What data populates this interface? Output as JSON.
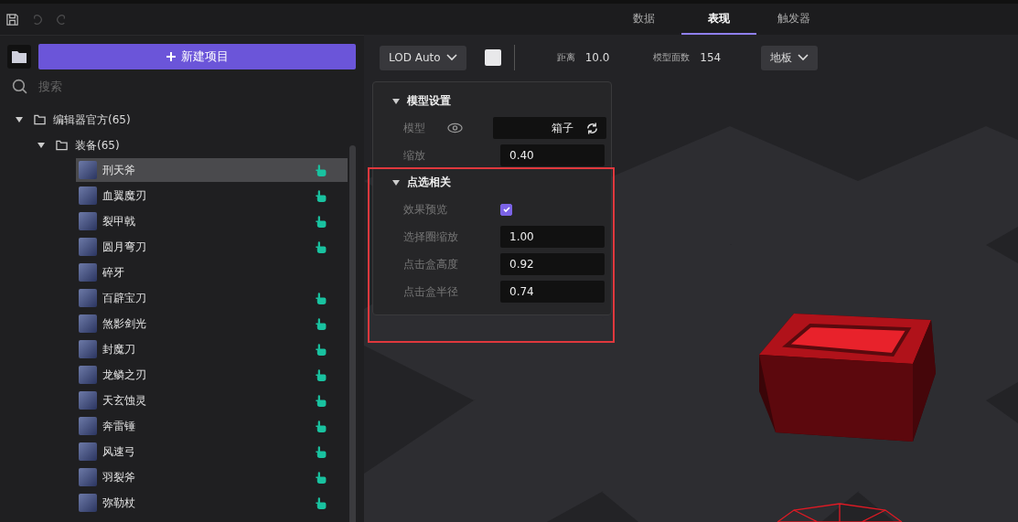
{
  "toolbar": {
    "undo_disabled": true,
    "redo_disabled": true
  },
  "tabs": [
    {
      "label": "数据",
      "selected": false
    },
    {
      "label": "表现",
      "selected": true
    },
    {
      "label": "触发器",
      "selected": false
    }
  ],
  "new_button": {
    "label": "新建项目"
  },
  "search": {
    "placeholder": "搜索"
  },
  "tree": [
    {
      "label": "编辑器官方(65)",
      "expanded": true,
      "children": [
        {
          "label": "装备(65)",
          "expanded": true,
          "children": [
            {
              "label": "刑天斧",
              "selected": true,
              "liked": true
            },
            {
              "label": "血翼魔刃",
              "selected": false,
              "liked": true
            },
            {
              "label": "裂甲戟",
              "selected": false,
              "liked": true
            },
            {
              "label": "圆月弯刀",
              "selected": false,
              "liked": true
            },
            {
              "label": "碎牙",
              "selected": false,
              "liked": false
            },
            {
              "label": "百辟宝刀",
              "selected": false,
              "liked": true
            },
            {
              "label": "煞影剑光",
              "selected": false,
              "liked": true
            },
            {
              "label": "封魔刀",
              "selected": false,
              "liked": true
            },
            {
              "label": "龙鳞之刃",
              "selected": false,
              "liked": true
            },
            {
              "label": "天玄蚀灵",
              "selected": false,
              "liked": true
            },
            {
              "label": "奔雷锤",
              "selected": false,
              "liked": true
            },
            {
              "label": "风速弓",
              "selected": false,
              "liked": true
            },
            {
              "label": "羽裂斧",
              "selected": false,
              "liked": true
            },
            {
              "label": "弥勒杖",
              "selected": false,
              "liked": true
            }
          ]
        }
      ]
    }
  ],
  "viewport_bar": {
    "lod": "LOD Auto",
    "distance_label": "距离",
    "distance": "10.0",
    "faces_label": "模型面数",
    "faces": "154",
    "floor": "地板"
  },
  "sections": [
    {
      "title": "模型设置",
      "expanded": true,
      "rows": [
        {
          "kind": "model",
          "label": "模型",
          "value": "箱子"
        },
        {
          "kind": "number",
          "label": "缩放",
          "value": "0.40"
        }
      ]
    },
    {
      "title": "点选相关",
      "expanded": true,
      "highlighted": true,
      "rows": [
        {
          "kind": "checkbox",
          "label": "效果预览",
          "checked": true
        },
        {
          "kind": "number",
          "label": "选择圈缩放",
          "value": "1.00"
        },
        {
          "kind": "number",
          "label": "点击盒高度",
          "value": "0.92"
        },
        {
          "kind": "number",
          "label": "点击盒半径",
          "value": "0.74"
        }
      ]
    }
  ]
}
